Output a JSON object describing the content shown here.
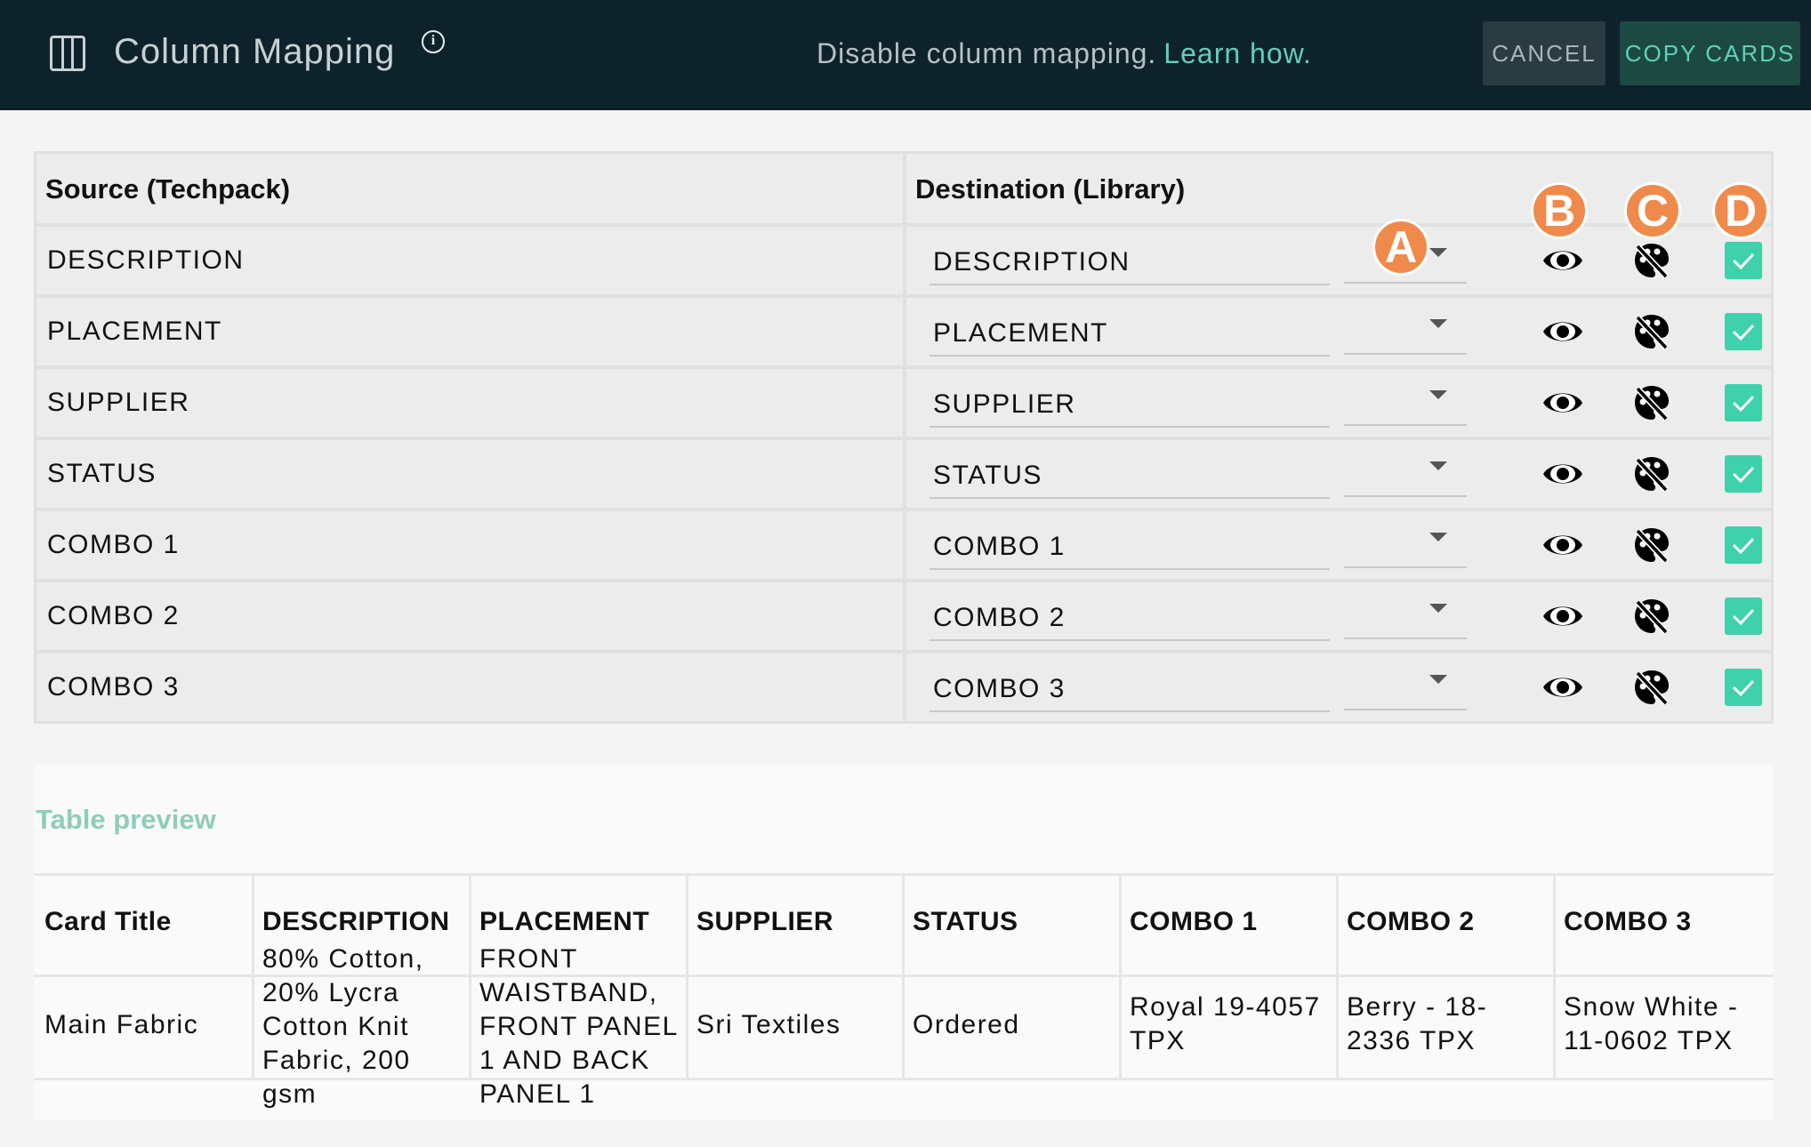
{
  "header": {
    "title": "Column Mapping",
    "info_glyph": "i",
    "disable_text": "Disable column mapping.",
    "learn_link": "Learn how.",
    "cancel_label": "CANCEL",
    "copy_label": "COPY CARDS"
  },
  "mapping": {
    "source_header": "Source (Techpack)",
    "destination_header": "Destination (Library)",
    "rows": [
      {
        "source": "DESCRIPTION",
        "destination": "DESCRIPTION"
      },
      {
        "source": "PLACEMENT",
        "destination": "PLACEMENT"
      },
      {
        "source": "SUPPLIER",
        "destination": "SUPPLIER"
      },
      {
        "source": "STATUS",
        "destination": "STATUS"
      },
      {
        "source": "COMBO 1",
        "destination": "COMBO 1"
      },
      {
        "source": "COMBO 2",
        "destination": "COMBO 2"
      },
      {
        "source": "COMBO 3",
        "destination": "COMBO 3"
      }
    ]
  },
  "badges": {
    "a": "A",
    "b": "B",
    "c": "C",
    "d": "D"
  },
  "preview": {
    "title": "Table preview",
    "columns": [
      "Card Title",
      "DESCRIPTION",
      "PLACEMENT",
      "SUPPLIER",
      "STATUS",
      "COMBO 1",
      "COMBO 2",
      "COMBO 3"
    ],
    "row": {
      "card_title": "Main Fabric",
      "description": "80% Cotton, 20% Lycra Cotton Knit Fabric, 200 gsm",
      "placement": "FRONT WAISTBAND, FRONT PANEL 1 AND BACK PANEL 1",
      "supplier": "Sri Textiles",
      "status": "Ordered",
      "combo1": "Royal 19-4057 TPX",
      "combo2": "Berry - 18-2336 TPX",
      "combo3": "Snow White - 11-0602 TPX"
    }
  },
  "colors": {
    "header_bg": "#0e222b",
    "accent": "#5fd0b7",
    "checkbox": "#3fd1ab",
    "badge": "#ef8a4b",
    "preview_title": "#8fcdb9"
  }
}
